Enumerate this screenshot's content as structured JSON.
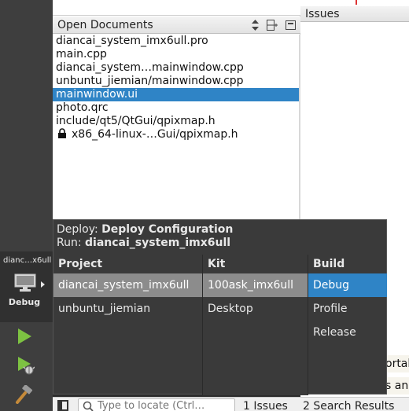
{
  "open_documents": {
    "title": "Open Documents",
    "items": [
      {
        "label": "diancai_system_imx6ull.pro",
        "locked": false,
        "selected": false
      },
      {
        "label": "main.cpp",
        "locked": false,
        "selected": false
      },
      {
        "label": "diancai_system…mainwindow.cpp",
        "locked": false,
        "selected": false
      },
      {
        "label": "unbuntu_jiemian/mainwindow.cpp",
        "locked": false,
        "selected": false
      },
      {
        "label": "mainwindow.ui",
        "locked": false,
        "selected": true
      },
      {
        "label": "photo.qrc",
        "locked": false,
        "selected": false
      },
      {
        "label": "include/qt5/QtGui/qpixmap.h",
        "locked": false,
        "selected": false
      },
      {
        "label": "x86_64-linux-…Gui/qpixmap.h",
        "locked": true,
        "selected": false
      }
    ]
  },
  "issues_pane": {
    "title": "Issues",
    "fragment_1": "ortal",
    "fragment_2": "s and"
  },
  "mode_bar": {
    "kit_name": "dianc…x6ull",
    "build_label": "Debug",
    "icons": [
      "monitor-icon",
      "run-icon",
      "debug-run-icon",
      "build-hammer-icon"
    ]
  },
  "popup": {
    "deploy_label": "Deploy:",
    "deploy_value": "Deploy Configuration",
    "run_label": "Run:",
    "run_value": "diancai_system_imx6ull",
    "columns": {
      "project": {
        "title": "Project",
        "rows": [
          "diancai_system_imx6ull",
          "unbuntu_jiemian"
        ],
        "selected": 0
      },
      "kit": {
        "title": "Kit",
        "rows": [
          "100ask_imx6ull",
          "Desktop"
        ],
        "selected": 0
      },
      "build": {
        "title": "Build",
        "rows": [
          "Debug",
          "Profile",
          "Release"
        ],
        "selected": 0
      }
    }
  },
  "status_bar": {
    "locator_placeholder": "Type to locate (Ctrl…",
    "tab_issues": "1  Issues",
    "tab_search": "2  Search Results"
  },
  "colors": {
    "selection_blue": "#2f84c6",
    "popup_background": "#3a3a3a",
    "run_green": "#7dc242"
  }
}
